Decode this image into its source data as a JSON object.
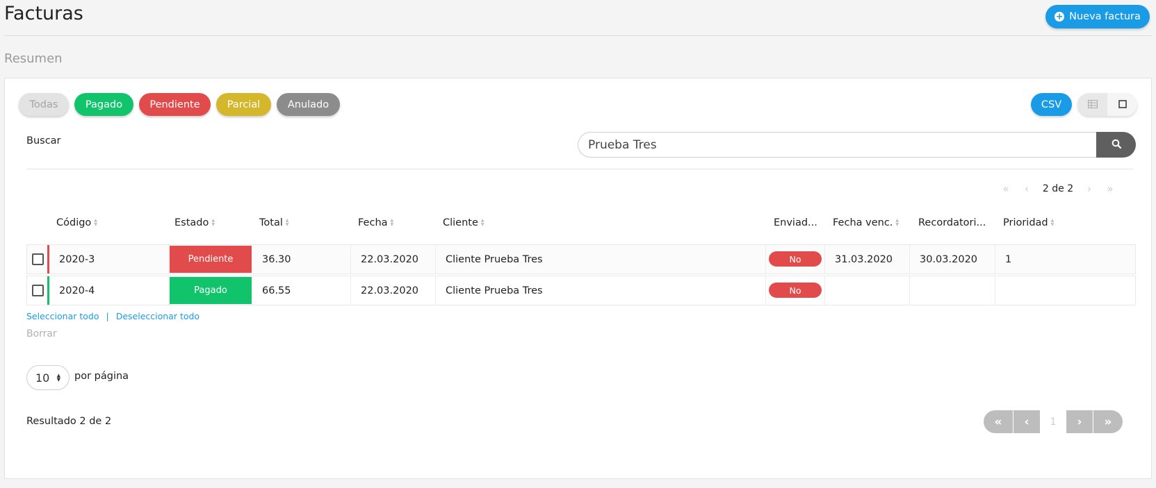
{
  "header": {
    "title": "Facturas",
    "new_label": "Nueva factura",
    "subtitle": "Resumen"
  },
  "filters": [
    {
      "label": "Todas",
      "color": "#e3e3e3"
    },
    {
      "label": "Pagado",
      "color": "#11c36b"
    },
    {
      "label": "Pendiente",
      "color": "#e24b4b"
    },
    {
      "label": "Parcial",
      "color": "#d4b72c"
    },
    {
      "label": "Anulado",
      "color": "#8c8c8c"
    }
  ],
  "toolbar": {
    "csv_label": "CSV",
    "view_table_icon": "table-icon",
    "view_card_icon": "square-icon"
  },
  "search": {
    "label": "Buscar",
    "value": "Prueba Tres"
  },
  "pagination_top": {
    "info": "2 de 2"
  },
  "table": {
    "columns": [
      "Código",
      "Estado",
      "Total",
      "Fecha",
      "Cliente",
      "Enviad...",
      "Fecha venc.",
      "Recordatori...",
      "Prioridad"
    ],
    "rows": [
      {
        "codigo": "2020-3",
        "estado": "Pendiente",
        "estado_color": "#e24b4b",
        "total": "36.30",
        "fecha": "22.03.2020",
        "cliente": "Cliente Prueba Tres",
        "enviado": "No",
        "fecha_venc": "31.03.2020",
        "recordatorio": "30.03.2020",
        "prioridad": "1"
      },
      {
        "codigo": "2020-4",
        "estado": "Pagado",
        "estado_color": "#11c36b",
        "total": "66.55",
        "fecha": "22.03.2020",
        "cliente": "Cliente Prueba Tres",
        "enviado": "No",
        "fecha_venc": "",
        "recordatorio": "",
        "prioridad": ""
      }
    ]
  },
  "actions": {
    "select_all": "Seleccionar todo",
    "separator": "|",
    "deselect_all": "Deseleccionar todo",
    "delete": "Borrar"
  },
  "per_page": {
    "value": "10",
    "label": "por página"
  },
  "footer": {
    "result": "Resultado 2 de 2",
    "current_page": "1"
  }
}
